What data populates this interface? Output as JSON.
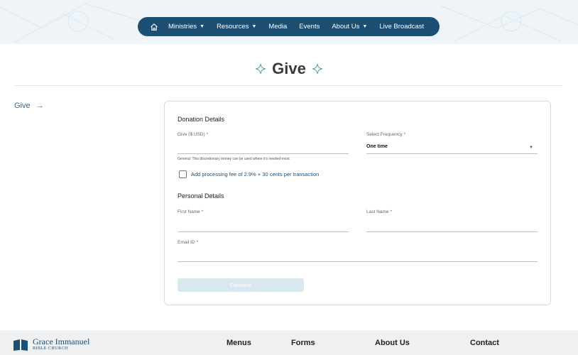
{
  "nav": {
    "items": [
      {
        "label": "Ministries",
        "has_dropdown": true
      },
      {
        "label": "Resources",
        "has_dropdown": true
      },
      {
        "label": "Media",
        "has_dropdown": false
      },
      {
        "label": "Events",
        "has_dropdown": false
      },
      {
        "label": "About Us",
        "has_dropdown": true
      },
      {
        "label": "Live Broadcast",
        "has_dropdown": false
      }
    ],
    "home_icon": "home-icon",
    "caret": "▼"
  },
  "page": {
    "title": "Give"
  },
  "sidebar": {
    "link_label": "Give",
    "arrow": "→"
  },
  "form": {
    "donation_section": "Donation Details",
    "give_label": "Give ($ USD)",
    "give_value": "",
    "give_hint": "General: This discretionary money can be used where it's needed most.",
    "frequency_label": "Select Frequency",
    "frequency_value": "One time",
    "required_mark": "*",
    "select_caret": "▼",
    "processing_fee_label": "Add processing fee of 2.9% + 30 cents per transaction",
    "processing_fee_checked": false,
    "personal_section": "Personal Details",
    "first_name_label": "First Name",
    "last_name_label": "Last Name",
    "email_label": "Email ID",
    "continue_label": "Continue"
  },
  "footer": {
    "logo_name": "Grace Immanuel",
    "logo_sub": "BIBLE CHURCH",
    "columns": [
      "Menus",
      "Forms",
      "About Us",
      "Contact"
    ]
  },
  "colors": {
    "primary": "#1d4e73",
    "link": "#2b6b94",
    "required": "#d23a3a",
    "accent_ornament": "#4fa7a0",
    "button_disabled": "#d9e8ef"
  }
}
